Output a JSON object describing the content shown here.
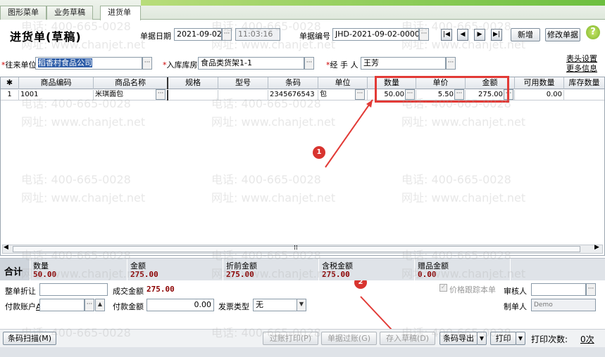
{
  "tabs": [
    {
      "label": "图形菜单",
      "active": false
    },
    {
      "label": "业务草稿",
      "active": false
    },
    {
      "label": "进货单",
      "active": true
    }
  ],
  "header": {
    "title": "进货单(草稿)",
    "date_label": "单据日期",
    "date_value": "2021-09-02",
    "time_value": "11:03:16",
    "docno_label": "单据编号",
    "docno_value": "JHD-2021-09-02-00001",
    "new_button": "新增",
    "edit_button": "修改单据",
    "help_icon": "?"
  },
  "form": {
    "supplier_label": "往来单位",
    "supplier_value": "稻香村食品公司",
    "warehouse_label": "入库库房",
    "warehouse_value": "食品类货架1-1",
    "handler_label": "经 手 人",
    "handler_value": "王芳",
    "header_settings_link": "表头设置",
    "more_info_link": "更多信息"
  },
  "grid": {
    "columns": [
      "商品编码",
      "商品名称",
      "规格",
      "型号",
      "条码",
      "单位",
      "数量",
      "单价",
      "金额",
      "可用数量",
      "库存数量"
    ],
    "rows": [
      {
        "no": "1",
        "code": "1001",
        "name": "米琪面包",
        "spec": "",
        "model": "",
        "barcode": "2345676543",
        "unit": "包",
        "qty": "50.00",
        "price": "5.50",
        "amount": "275.00",
        "available": "0.00",
        "stock": ""
      }
    ]
  },
  "totals": {
    "label": "合计",
    "items": [
      {
        "label": "数量",
        "value": "50.00"
      },
      {
        "label": "金额",
        "value": "275.00"
      },
      {
        "label": "折前金额",
        "value": "275.00"
      },
      {
        "label": "含税金额",
        "value": "275.00"
      },
      {
        "label": "赠品金额",
        "value": "0.00"
      }
    ]
  },
  "bottom_form": {
    "discount_label": "整单折让",
    "deal_amount_label": "成交金额",
    "deal_amount_value": "275.00",
    "pay_account_label": "付款账户",
    "pay_account_mnemonic": "A",
    "pay_amount_label": "付款金额",
    "pay_amount_value": "0.00",
    "invoice_label": "发票类型",
    "invoice_value": "无",
    "price_track_label": "价格跟踪本单",
    "auditor_label": "审核人",
    "maker_label": "制单人",
    "maker_value": "Demo"
  },
  "footer": {
    "scan_button": "条码扫描(M)",
    "post_print_button": "过账打印(P)",
    "post_button": "单据过账(G)",
    "save_draft_button": "存入草稿(D)",
    "barcode_export_button": "条码导出",
    "print_button": "打印",
    "print_count_label": "打印次数:",
    "print_count_value": "0次"
  },
  "annotations": {
    "marker1": "1",
    "marker2": "2"
  },
  "watermark": {
    "phone": "电话: 400-665-0028",
    "site": "网址: www.chanjet.net"
  },
  "colors": {
    "annotation_red": "#e23a36",
    "total_value": "#8b0000",
    "required_star": "#cc0000"
  }
}
